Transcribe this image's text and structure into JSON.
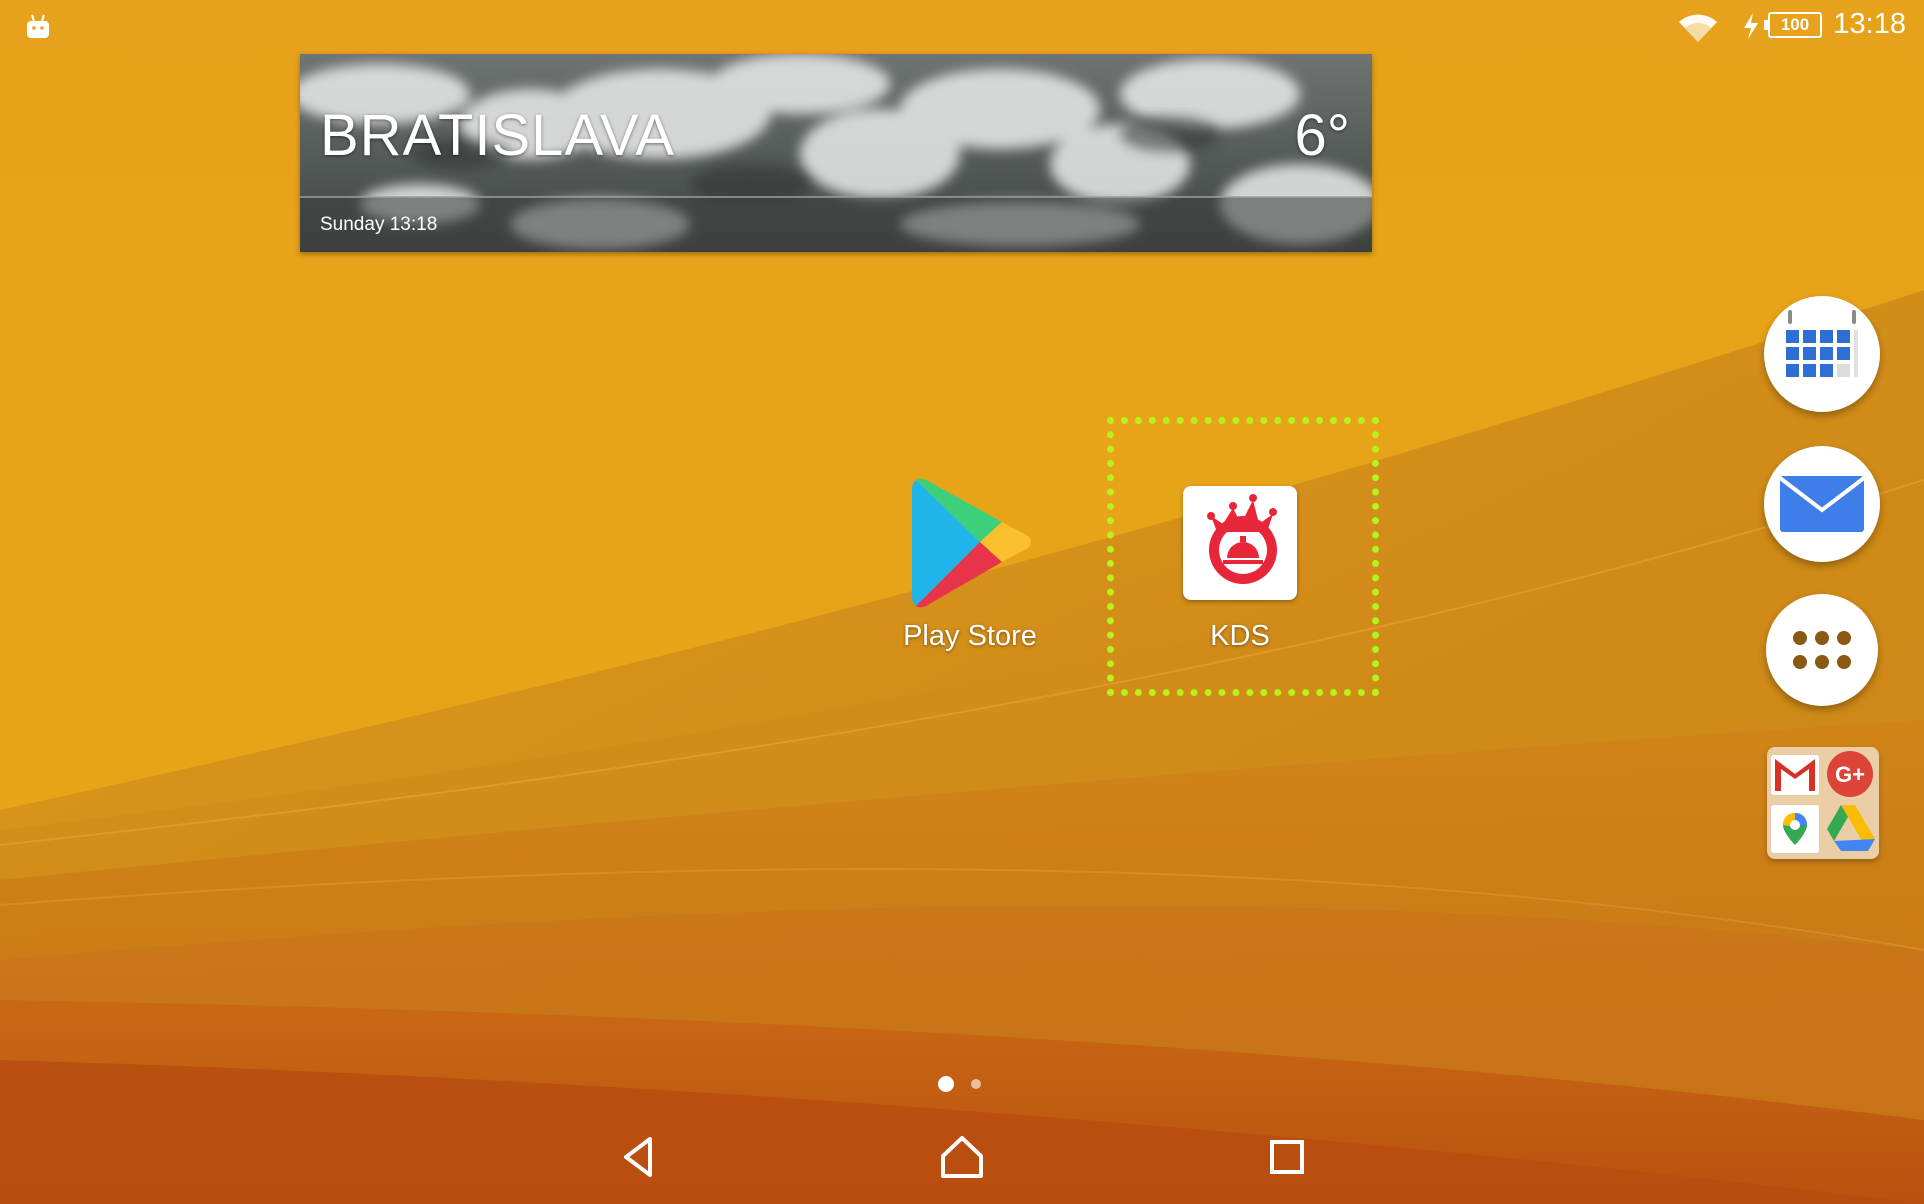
{
  "status_bar": {
    "time": "13:18",
    "battery_level": "100",
    "icons": [
      "android-notification-icon",
      "wifi-icon",
      "charging-bolt-icon",
      "battery-icon"
    ]
  },
  "weather_widget": {
    "city": "BRATISLAVA",
    "temperature": "6°",
    "date_time": "Sunday 13:18"
  },
  "apps": [
    {
      "label": "Play Store",
      "icon": "play-store-icon"
    },
    {
      "label": "KDS",
      "icon": "kds-icon"
    }
  ],
  "dock": [
    {
      "name": "calendar",
      "icon": "calendar-icon"
    },
    {
      "name": "email",
      "icon": "mail-icon"
    },
    {
      "name": "app-drawer",
      "icon": "app-drawer-icon"
    },
    {
      "name": "google-folder",
      "icon": "folder-icon",
      "contents": [
        "gmail-icon",
        "google-plus-icon",
        "maps-icon",
        "drive-icon"
      ]
    }
  ],
  "pagination": {
    "pages": 2,
    "current": 1
  },
  "navigation": [
    "back-icon",
    "home-icon",
    "recents-icon"
  ],
  "colors": {
    "wallpaper_light": "#eeaa12",
    "wallpaper_dark": "#c55a12",
    "selection_highlight": "#b6f21c",
    "kds_red": "#e8263a"
  }
}
